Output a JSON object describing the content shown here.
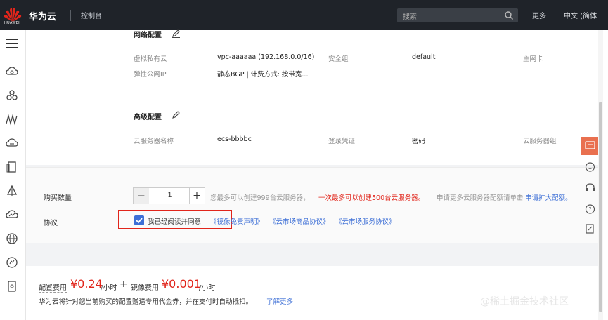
{
  "topbar": {
    "logo_text": "HUAWEI",
    "brand": "华为云",
    "console": "控制台",
    "search_placeholder": "搜索",
    "more": "更多",
    "language": "中文 (简体"
  },
  "config": {
    "network_section_title": "网络配置",
    "network": [
      {
        "label": "虚拟私有云",
        "value": "vpc-aaaaaa (192.168.0.0/16)"
      },
      {
        "label": "安全组",
        "value": "default"
      },
      {
        "label": "主网卡",
        "value": ""
      },
      {
        "label": "弹性公网IP",
        "value": "静态BGP | 计费方式: 按带宽..."
      }
    ],
    "advanced_section_title": "高级配置",
    "advanced": [
      {
        "label": "云服务器名称",
        "value": "ecs-bbbbc"
      },
      {
        "label": "登录凭证",
        "value": "密码"
      },
      {
        "label": "云服务器组",
        "value": ""
      }
    ]
  },
  "purchase": {
    "quantity_label": "购买数量",
    "quantity_value": "1",
    "hint_gray": "您最多可以创建999台云服务器，",
    "hint_red": "一次最多可以创建500台云服务器。",
    "hint_gray2": "申请更多云服务器配额请单击",
    "hint_link": "申请扩大配额。",
    "agreement_label": "协议",
    "agree_text": "我已经阅读并同意",
    "agreement_links": [
      "《镜像免责声明》",
      "《云市场商品协议》",
      "《云市场服务协议》"
    ]
  },
  "fees": {
    "config_fee_label": "配置费用",
    "config_fee_price": "¥0.24",
    "config_fee_unit": "/小时",
    "image_fee_label": "镜像费用",
    "image_fee_price": "¥0.001",
    "image_fee_unit": "/小时",
    "notice": "华为云将针对您当前购买的配置赠送专用代金券，并在支付时自动抵扣。",
    "notice_link": "了解更多"
  },
  "watermark": "@稀土掘金技术社区",
  "colors": {
    "accent_red": "#e1251b",
    "link_blue": "#3d6fd6",
    "topbar": "#1f2329",
    "float_active": "#e9704f"
  }
}
